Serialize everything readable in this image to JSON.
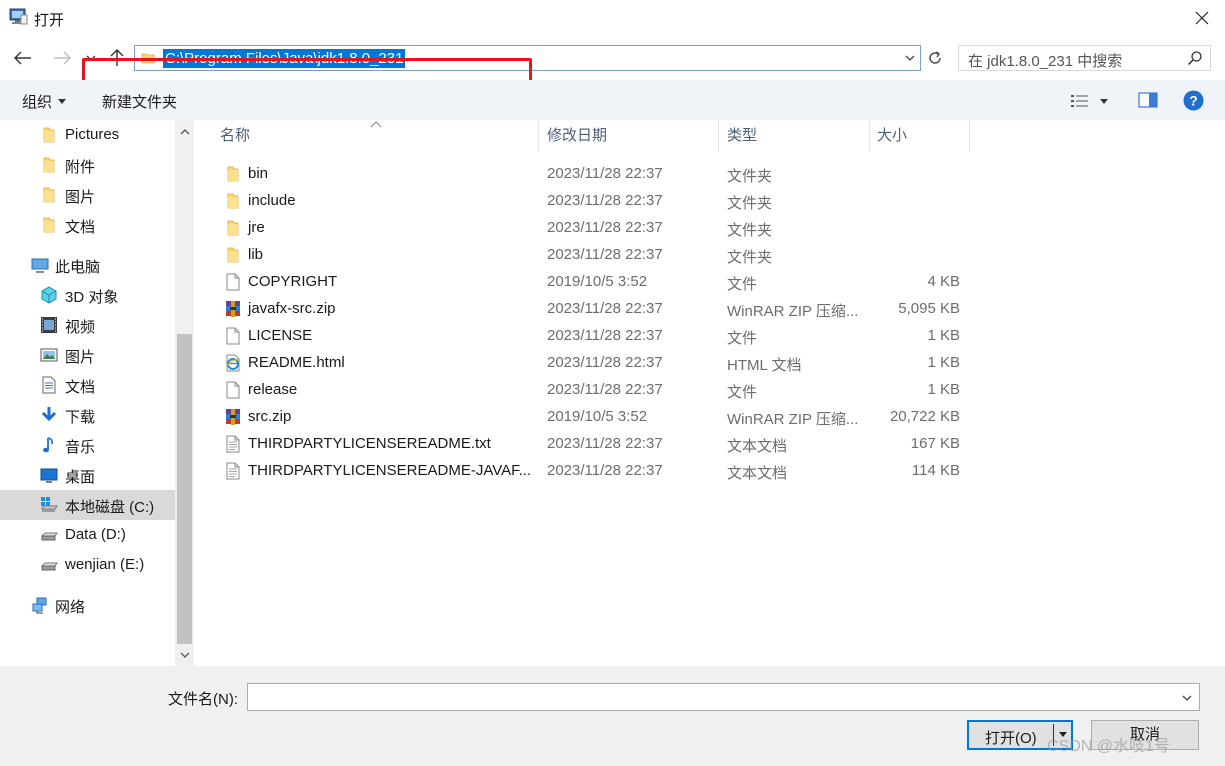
{
  "window": {
    "title": "打开",
    "close_glyph": "✕"
  },
  "nav": {
    "address_path": "C:\\Program Files\\Java\\jdk1.8.0_231",
    "search_placeholder": "在 jdk1.8.0_231 中搜索"
  },
  "toolbar": {
    "organize_label": "组织",
    "new_folder_label": "新建文件夹"
  },
  "sidebar": {
    "items": [
      {
        "label": "Pictures",
        "icon": "folder-icon"
      },
      {
        "label": "附件",
        "icon": "folder-icon"
      },
      {
        "label": "图片",
        "icon": "folder-icon"
      },
      {
        "label": "文档",
        "icon": "folder-icon"
      },
      {
        "label": "此电脑",
        "icon": "this-pc-icon"
      },
      {
        "label": "3D 对象",
        "icon": "3d-objects-icon"
      },
      {
        "label": "视频",
        "icon": "videos-icon"
      },
      {
        "label": "图片",
        "icon": "pictures-icon"
      },
      {
        "label": "文档",
        "icon": "documents-icon"
      },
      {
        "label": "下载",
        "icon": "downloads-icon"
      },
      {
        "label": "音乐",
        "icon": "music-icon"
      },
      {
        "label": "桌面",
        "icon": "desktop-icon"
      },
      {
        "label": "本地磁盘 (C:)",
        "icon": "windows-drive-icon",
        "selected": true
      },
      {
        "label": "Data (D:)",
        "icon": "drive-icon"
      },
      {
        "label": "wenjian (E:)",
        "icon": "drive-icon"
      },
      {
        "label": "网络",
        "icon": "network-icon"
      }
    ]
  },
  "columns": {
    "name": "名称",
    "date": "修改日期",
    "type": "类型",
    "size": "大小"
  },
  "files": [
    {
      "name": "bin",
      "date": "2023/11/28 22:37",
      "type": "文件夹",
      "size": "",
      "icon": "folder-icon"
    },
    {
      "name": "include",
      "date": "2023/11/28 22:37",
      "type": "文件夹",
      "size": "",
      "icon": "folder-icon"
    },
    {
      "name": "jre",
      "date": "2023/11/28 22:37",
      "type": "文件夹",
      "size": "",
      "icon": "folder-icon"
    },
    {
      "name": "lib",
      "date": "2023/11/28 22:37",
      "type": "文件夹",
      "size": "",
      "icon": "folder-icon"
    },
    {
      "name": "COPYRIGHT",
      "date": "2019/10/5 3:52",
      "type": "文件",
      "size": "4 KB",
      "icon": "file-icon"
    },
    {
      "name": "javafx-src.zip",
      "date": "2023/11/28 22:37",
      "type": "WinRAR ZIP 压缩...",
      "size": "5,095 KB",
      "icon": "winrar-icon"
    },
    {
      "name": "LICENSE",
      "date": "2023/11/28 22:37",
      "type": "文件",
      "size": "1 KB",
      "icon": "file-icon"
    },
    {
      "name": "README.html",
      "date": "2023/11/28 22:37",
      "type": "HTML 文档",
      "size": "1 KB",
      "icon": "ie-html-icon"
    },
    {
      "name": "release",
      "date": "2023/11/28 22:37",
      "type": "文件",
      "size": "1 KB",
      "icon": "file-icon"
    },
    {
      "name": "src.zip",
      "date": "2019/10/5 3:52",
      "type": "WinRAR ZIP 压缩...",
      "size": "20,722 KB",
      "icon": "winrar-icon"
    },
    {
      "name": "THIRDPARTYLICENSEREADME.txt",
      "date": "2023/11/28 22:37",
      "type": "文本文档",
      "size": "167 KB",
      "icon": "text-file-icon"
    },
    {
      "name": "THIRDPARTYLICENSEREADME-JAVAF...",
      "date": "2023/11/28 22:37",
      "type": "文本文档",
      "size": "114 KB",
      "icon": "text-file-icon"
    }
  ],
  "bottom": {
    "filename_label": "文件名(N):",
    "filename_value": "",
    "open_label": "打开(O)",
    "cancel_label": "取消"
  },
  "watermark": "CSDN @水吱1号",
  "colors": {
    "accent": "#0078d7",
    "highlight_box": "#e8141a",
    "selected_bg": "#d9d9d9"
  }
}
